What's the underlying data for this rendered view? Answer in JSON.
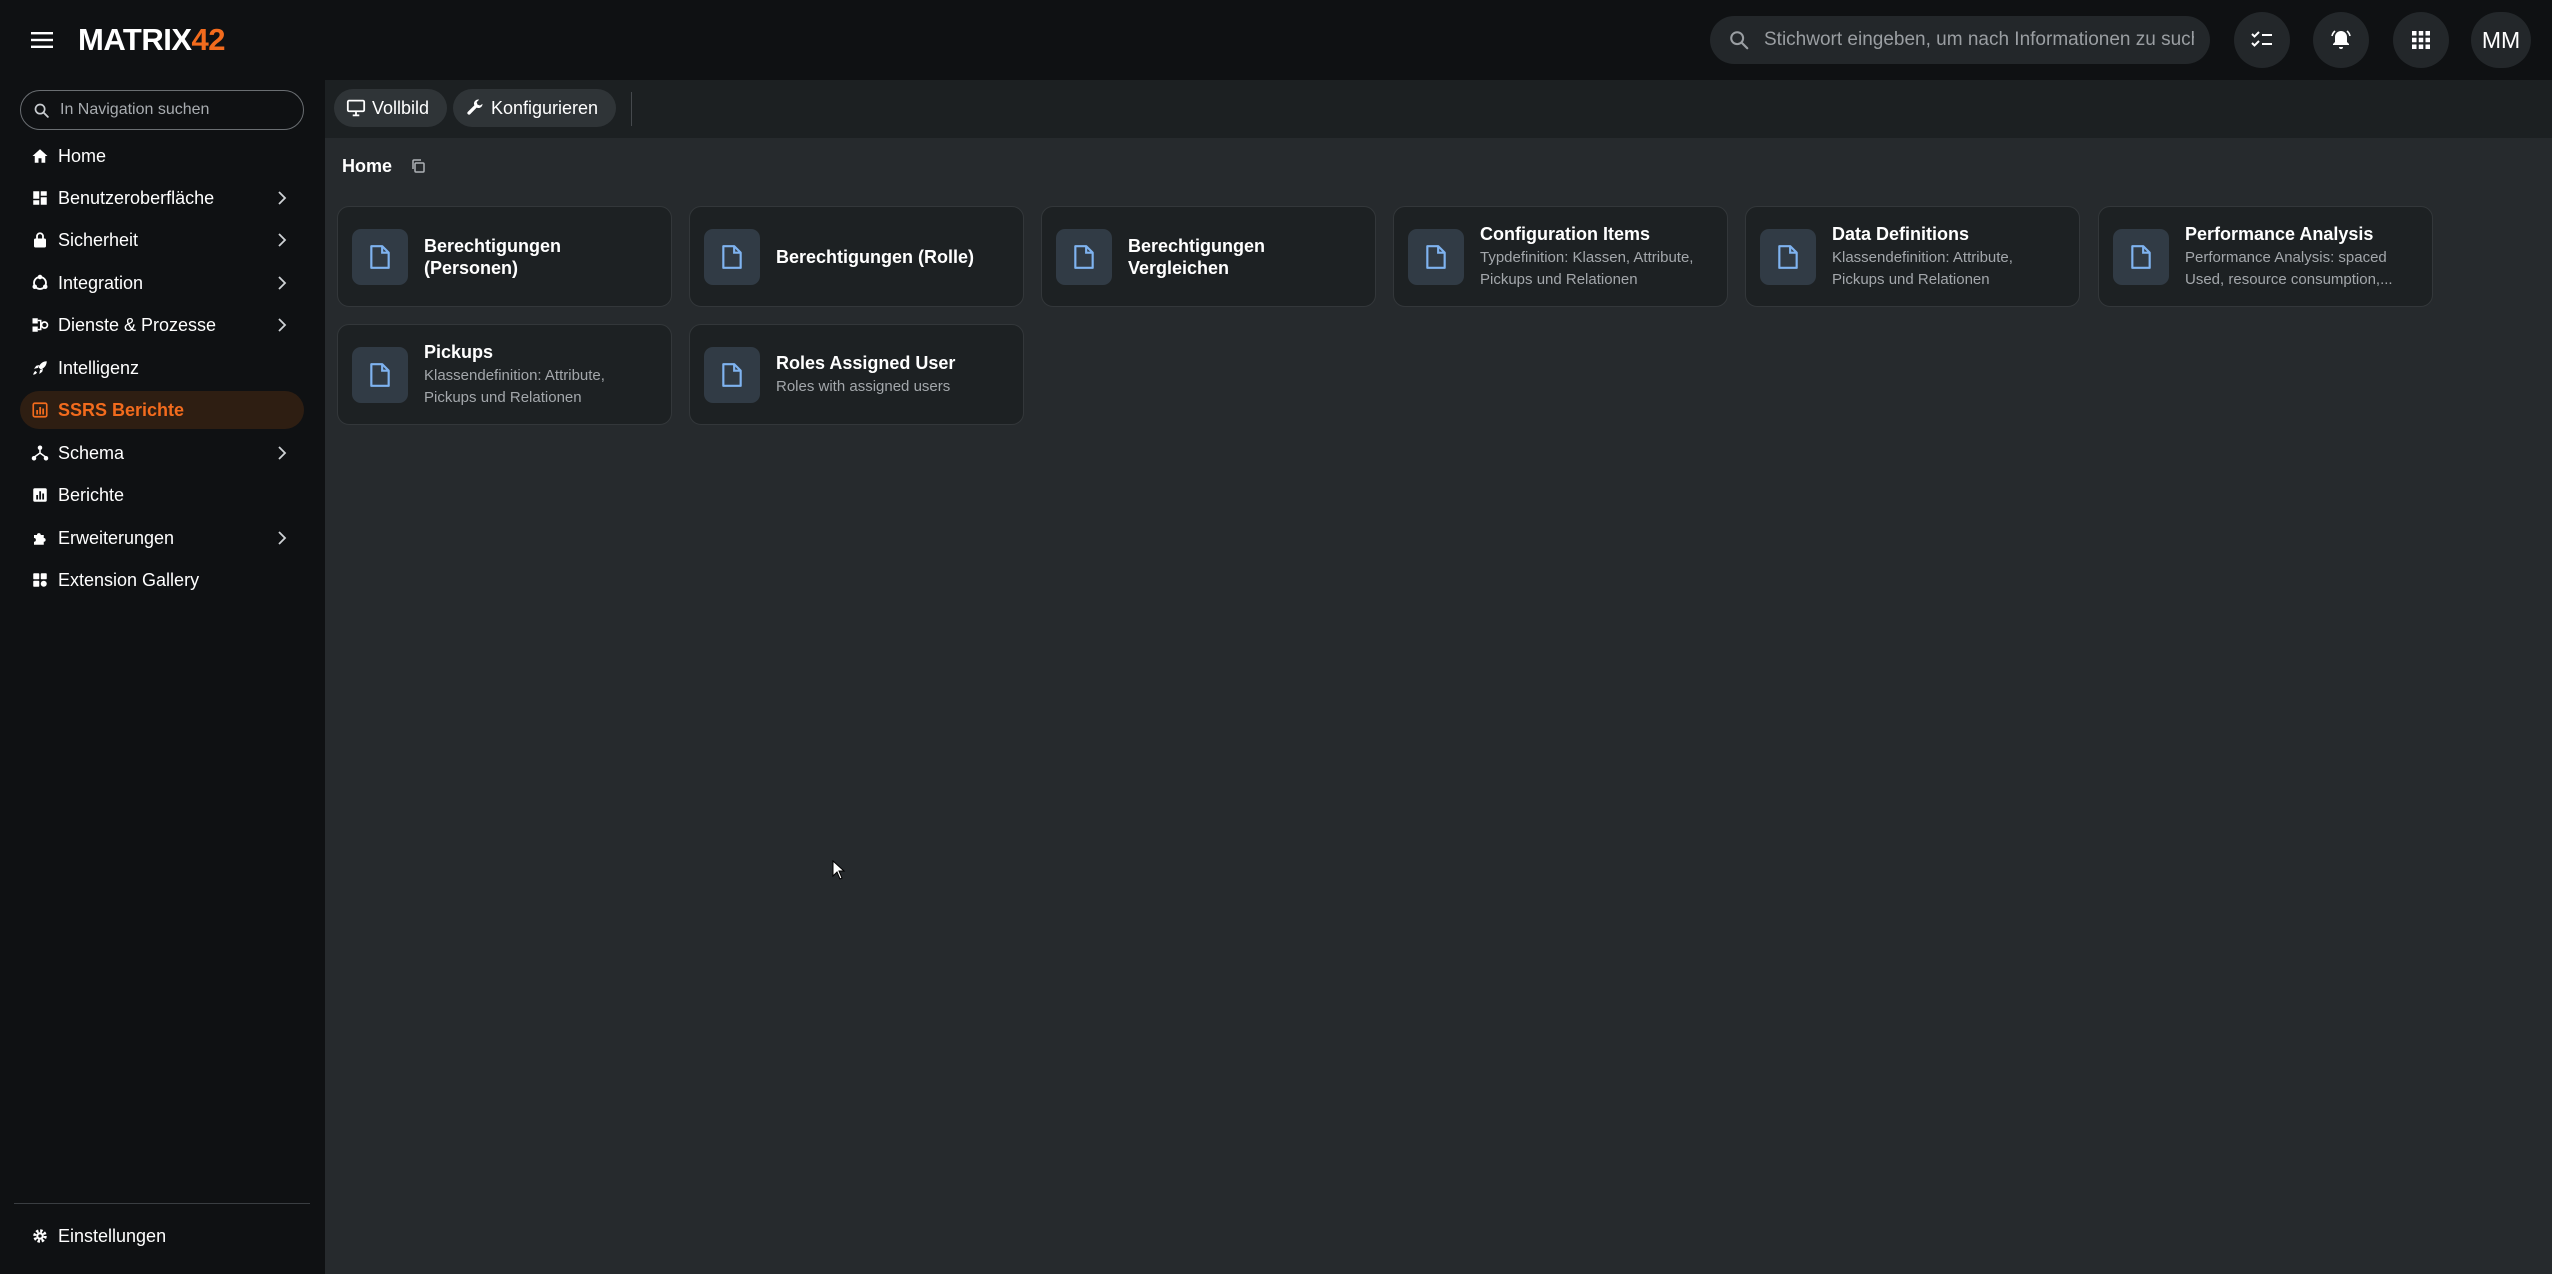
{
  "app": {
    "logo_main": "MATRIX",
    "logo_accent": "42",
    "avatar_initials": "MM"
  },
  "header": {
    "search_placeholder": "Stichwort eingeben, um nach Informationen zu suchen"
  },
  "sidebar": {
    "search_placeholder": "In Navigation suchen",
    "items": [
      {
        "label": "Home",
        "icon": "home-icon"
      },
      {
        "label": "Benutzeroberfläche",
        "icon": "dashboard-icon"
      },
      {
        "label": "Sicherheit",
        "icon": "lock-icon"
      },
      {
        "label": "Integration",
        "icon": "integration-icon"
      },
      {
        "label": "Dienste & Prozesse",
        "icon": "process-icon"
      },
      {
        "label": "Intelligenz",
        "icon": "rocket-icon"
      },
      {
        "label": "SSRS Berichte",
        "icon": "bar-chart-icon",
        "active": true
      },
      {
        "label": "Schema",
        "icon": "schema-icon"
      },
      {
        "label": "Berichte",
        "icon": "report-icon"
      },
      {
        "label": "Erweiterungen",
        "icon": "puzzle-icon"
      },
      {
        "label": "Extension Gallery",
        "icon": "gallery-icon"
      }
    ],
    "settings_label": "Einstellungen"
  },
  "toolbar": {
    "fullscreen_label": "Vollbild",
    "configure_label": "Konfigurieren"
  },
  "breadcrumb": {
    "current": "Home"
  },
  "cards": [
    {
      "title": "Berechtigungen (Personen)",
      "desc1": "",
      "desc2": ""
    },
    {
      "title": "Berechtigungen (Rolle)",
      "desc1": "",
      "desc2": ""
    },
    {
      "title": "Berechtigungen Vergleichen",
      "desc1": "",
      "desc2": ""
    },
    {
      "title": "Configuration Items",
      "desc1": "Typdefinition: Klassen, Attribute,",
      "desc2": "Pickups und Relationen"
    },
    {
      "title": "Data Definitions",
      "desc1": "Klassendefinition: Attribute,",
      "desc2": "Pickups und Relationen"
    },
    {
      "title": "Performance Analysis",
      "desc1": "Performance Analysis: spaced",
      "desc2": "Used, resource consumption,..."
    },
    {
      "title": "Pickups",
      "desc1": "Klassendefinition: Attribute,",
      "desc2": "Pickups und Relationen"
    },
    {
      "title": "Roles Assigned User",
      "desc1": "Roles with assigned users",
      "desc2": ""
    }
  ],
  "colors": {
    "accent": "#f26b1d",
    "card_icon": "#7fb3f0"
  }
}
